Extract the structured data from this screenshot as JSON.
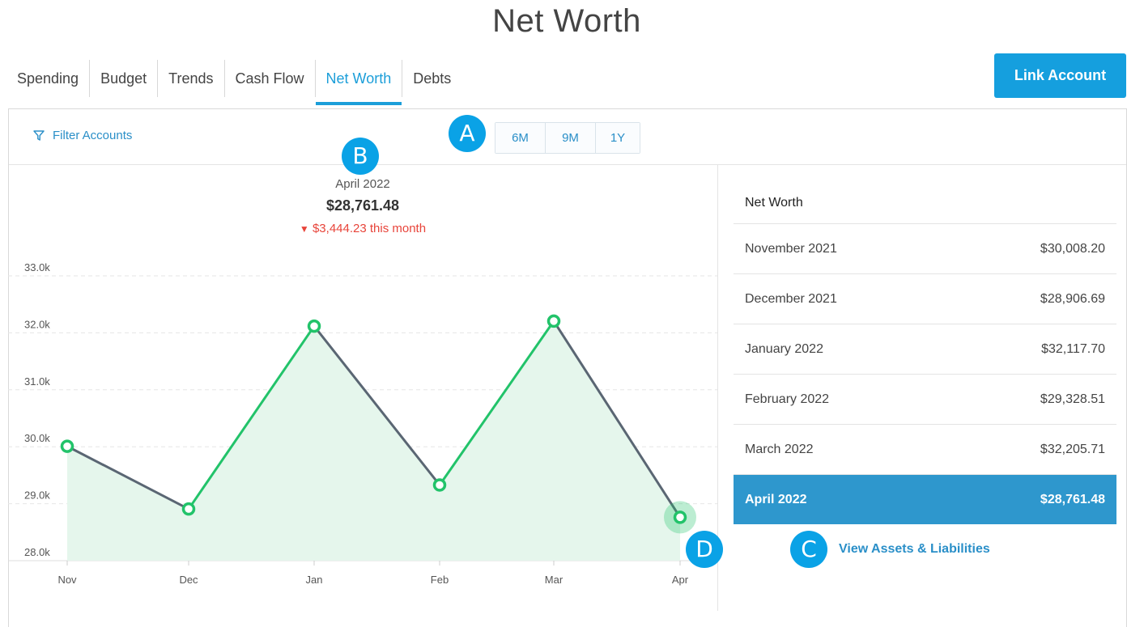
{
  "page": {
    "title": "Net Worth"
  },
  "tabs": [
    "Spending",
    "Budget",
    "Trends",
    "Cash Flow",
    "Net Worth",
    "Debts"
  ],
  "active_tab": "Net Worth",
  "link_account_label": "Link Account",
  "filter_label": "Filter Accounts",
  "ranges": [
    "6M",
    "9M",
    "1Y"
  ],
  "badges": {
    "a": "A",
    "b": "B",
    "c": "C",
    "d": "D"
  },
  "summary": {
    "month": "April 2022",
    "value": "$28,761.48",
    "change": "$3,444.23 this month"
  },
  "side": {
    "title": "Net Worth",
    "rows": [
      {
        "label": "November 2021",
        "value": "$30,008.20"
      },
      {
        "label": "December 2021",
        "value": "$28,906.69"
      },
      {
        "label": "January 2022",
        "value": "$32,117.70"
      },
      {
        "label": "February 2022",
        "value": "$29,328.51"
      },
      {
        "label": "March 2022",
        "value": "$32,205.71"
      },
      {
        "label": "April 2022",
        "value": "$28,761.48"
      }
    ],
    "active_index": 5
  },
  "view_link_label": "View Assets & Liabilities",
  "colors": {
    "accent": "#1b9ed9",
    "up": "#22c36a",
    "down": "#5a6673",
    "negative": "#e8443a",
    "fill": "#e5f6ec"
  },
  "chart_data": {
    "type": "line",
    "categories": [
      "Nov",
      "Dec",
      "Jan",
      "Feb",
      "Mar",
      "Apr"
    ],
    "values": [
      30008.2,
      28906.69,
      32117.7,
      29328.51,
      32205.71,
      28761.48
    ],
    "yticks": [
      "28.0k",
      "29.0k",
      "30.0k",
      "31.0k",
      "32.0k",
      "33.0k"
    ],
    "ylim": [
      28000,
      33000
    ],
    "grid": true,
    "highlight": "Apr"
  }
}
